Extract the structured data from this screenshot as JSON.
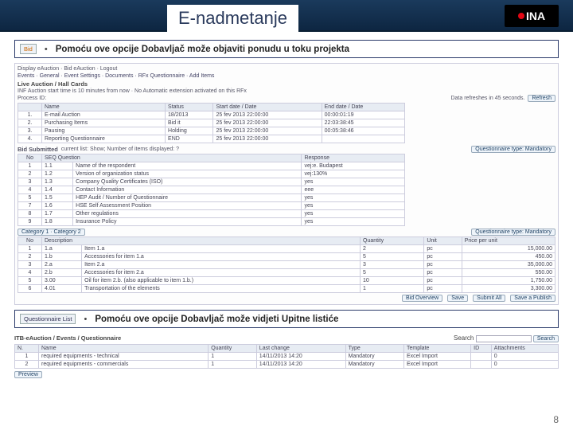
{
  "title": "E-nadmetanje",
  "logo": "INA",
  "callout1": {
    "btn": "Bid",
    "text": "Pomoću ove opcije Dobavljač može objaviti ponudu u toku projekta"
  },
  "callout2": {
    "btn": "Questionnaire List",
    "text": "Pomoću ove opcije Dobavljač može vidjeti Upitne listiće"
  },
  "shot1": {
    "topmenu": "Display eAuction · Bid eAuction · Logout",
    "tabs": "Events · General · Event Settings · Documents · RFx Questionnaire · Add Items",
    "heading": "Live Auction / Hall Cards",
    "infoline": "INF Auction start time is 10 minutes from now · No Automatic extension activated on this RFx",
    "process_label": "Process ID:",
    "refresh_note": "Data refreshes in 45 seconds.",
    "refresh_btn": "Refresh",
    "event_header": [
      "",
      "Name",
      "Status",
      "Start date / Date",
      "End date / Date"
    ],
    "events": [
      [
        "1.",
        "E-mail Auction",
        "18/2013",
        "25 fev 2013 22:00:00",
        "00:00:01:19"
      ],
      [
        "2.",
        "Purchasing Items",
        "Bid it",
        "25 fev 2013 22:00:00",
        "22:03:38:45"
      ],
      [
        "3.",
        "Pausing",
        "Holding",
        "25 fev 2013 22:00:00",
        "00:05:38:46"
      ],
      [
        "4.",
        "Reporting Questionnaire",
        "END",
        "25 fev 2013 22:00:00",
        ""
      ]
    ],
    "bid_label": "Bid Submitted",
    "bid_note": "current list: Show; Number of items displayed: ?",
    "dropdown_label": "Questionnaire type: Mandatory",
    "seq_header": [
      "No",
      "SEQ Question",
      "Response"
    ],
    "seq_rows": [
      [
        "1",
        "1.1",
        "Name of the respondent",
        "vej:e. Budapest"
      ],
      [
        "2",
        "1.2",
        "Version of organization status",
        "vej:130%"
      ],
      [
        "3",
        "1.3",
        "Company Quality Certificates (ISO)",
        "yes"
      ],
      [
        "4",
        "1.4",
        "Contact Information",
        "eee"
      ],
      [
        "5",
        "1.5",
        "HEP Audit / Number of Questionnaire",
        "yes"
      ],
      [
        "7",
        "1.6",
        "HSE Self Assessment Position",
        "yes"
      ],
      [
        "8",
        "1.7",
        "Other regulations",
        "yes"
      ],
      [
        "9",
        "1.8",
        "Insurance Policy",
        "yes"
      ]
    ],
    "items_tab": "Category 1 · Category 2",
    "items_drop": "Questionnaire type: Mandatory",
    "items_header": [
      "No",
      "Description",
      "Quantity",
      "Unit",
      "Price per unit"
    ],
    "items": [
      [
        "1",
        "1.a",
        "Item 1.a",
        "2",
        "pc",
        "15,000.00"
      ],
      [
        "2",
        "1.b",
        "Accessories for item 1.a",
        "5",
        "pc",
        "450.00"
      ],
      [
        "3",
        "2.a",
        "Item 2.a",
        "3",
        "pc",
        "35,000.00"
      ],
      [
        "4",
        "2.b",
        "Accessories for item 2.a",
        "5",
        "pc",
        "550.00"
      ],
      [
        "5",
        "3.00",
        "Oil for item 2.b. (also applicable to item 1.b.)",
        "10",
        "pc",
        "1,750.00"
      ],
      [
        "6",
        "4.01",
        "Transportation of the elements",
        "1",
        "pc",
        "3,300.00"
      ]
    ],
    "btns": [
      "Bid Overview",
      "Save",
      "Submit All",
      "Save a Publish"
    ]
  },
  "shot2": {
    "breadcrumb": "ITB-eAuction / Events / Questionnaire",
    "search_label": "Search",
    "search_btn": "Search",
    "header": [
      "N.",
      "Name",
      "Quantity",
      "Last change",
      "Type",
      "Template",
      "ID",
      "Attachments"
    ],
    "rows": [
      [
        "1",
        "required equipments - technical",
        "1",
        "14/11/2013 14:20",
        "Mandatory",
        "Excel Import",
        "",
        "0"
      ],
      [
        "2",
        "required equipments - commercials",
        "1",
        "14/11/2013 14:20",
        "Mandatory",
        "Excel Import",
        "",
        "0"
      ]
    ],
    "preview": "Preview"
  },
  "page_number": "8"
}
